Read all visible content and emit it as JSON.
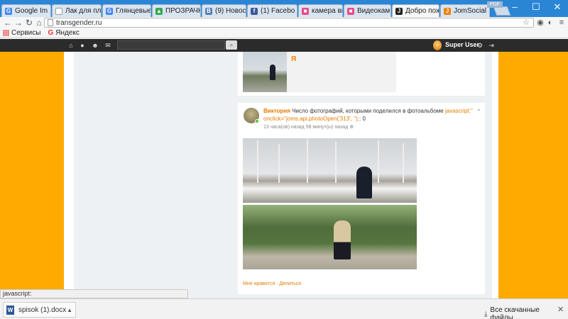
{
  "browser": {
    "tabs": [
      {
        "title": "Google Im",
        "icon": "google-icon",
        "color": "#4285f4",
        "glyph": "G"
      },
      {
        "title": "Лак для пл",
        "icon": "doc-icon",
        "color": "#ffffff",
        "glyph": ""
      },
      {
        "title": "Глянцевые",
        "icon": "google-icon",
        "color": "#4285f4",
        "glyph": "G"
      },
      {
        "title": "ПРОЗРАЧН",
        "icon": "drive-icon",
        "color": "#34a853",
        "glyph": "▲"
      },
      {
        "title": "(9) Новост",
        "icon": "vk-icon",
        "color": "#5181b8",
        "glyph": "В"
      },
      {
        "title": "(1) Facebo",
        "icon": "facebook-icon",
        "color": "#3b5998",
        "glyph": "f"
      },
      {
        "title": "камера ви",
        "icon": "market-icon",
        "color": "#e94b8a",
        "glyph": "■"
      },
      {
        "title": "Видеокам",
        "icon": "market-icon",
        "color": "#e94b8a",
        "glyph": "■"
      },
      {
        "title": "Добро пож",
        "icon": "joomla-icon",
        "color": "#222222",
        "glyph": "J"
      },
      {
        "title": "JomSocial",
        "icon": "jomsocial-icon",
        "color": "#f08000",
        "glyph": "J"
      }
    ],
    "active_tab": 8,
    "badge": "PDF",
    "url": "transgender.ru",
    "bookmarks": [
      {
        "label": "Сервисы",
        "icon": "apps-icon"
      },
      {
        "label": "Яндекс",
        "icon": "yandex-icon"
      }
    ]
  },
  "site": {
    "user_name": "Super User",
    "card1_name": "Я",
    "post": {
      "author": "Виктория",
      "text": "Число фотографий, которыми поделился в фотоальбоме",
      "link": "javascript:\" onclick=\"joms.api.photoOpen('313', '');",
      "suffix": ": 0",
      "meta": "13 часа(ов) назад 58 минут(ы) назад",
      "like": "Мне нравится",
      "share": "Делиться"
    },
    "colors": {
      "accent": "#ffaa00",
      "link": "#e67a00",
      "toolbar": "#2b2b2b"
    }
  },
  "status": {
    "hover_link": "javascript:"
  },
  "downloads": {
    "file": "spisok (1).docx",
    "show_all": "Все скачанные файлы..."
  }
}
